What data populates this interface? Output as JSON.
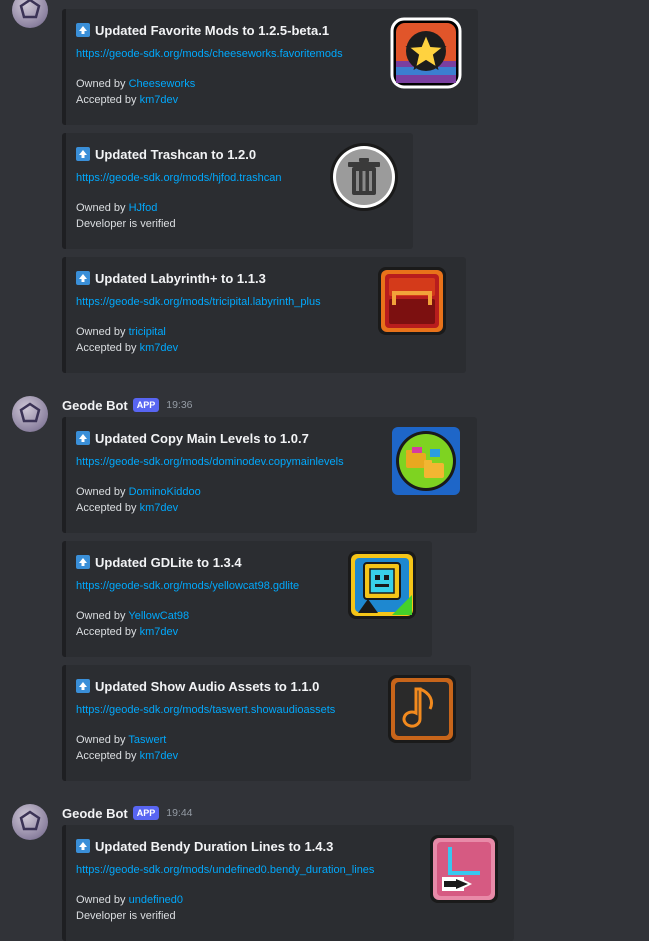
{
  "embed_fields": {
    "owned_by_label": "Owned by",
    "accepted_by_label": "Accepted by",
    "developer_verified_text": "Developer is verified"
  },
  "messages": [
    {
      "embeds": [
        {
          "title": "Updated Favorite Mods to 1.2.5-beta.1",
          "url": "https://geode-sdk.org/mods/cheeseworks.favoritemods",
          "owner": "Cheeseworks",
          "accepted_by": "km7dev",
          "icon": "star-mod-icon"
        },
        {
          "title": "Updated Trashcan to 1.2.0",
          "url": "https://geode-sdk.org/mods/hjfod.trashcan",
          "owner": "HJfod",
          "verified": true,
          "icon": "trashcan-mod-icon"
        },
        {
          "title": "Updated Labyrinth+ to 1.1.3",
          "url": "https://geode-sdk.org/mods/tricipital.labyrinth_plus",
          "owner": "tricipital",
          "accepted_by": "km7dev",
          "icon": "labyrinth-mod-icon"
        }
      ]
    },
    {
      "author": "Geode Bot",
      "tag": "APP",
      "time": "19:36",
      "embeds": [
        {
          "title": "Updated Copy Main Levels to 1.0.7",
          "url": "https://geode-sdk.org/mods/dominodev.copymainlevels",
          "owner": "DominoKiddoo",
          "accepted_by": "km7dev",
          "icon": "folder-mod-icon"
        },
        {
          "title": "Updated GDLite to 1.3.4",
          "url": "https://geode-sdk.org/mods/yellowcat98.gdlite",
          "owner": "YellowCat98",
          "accepted_by": "km7dev",
          "icon": "gd-cube-mod-icon"
        },
        {
          "title": "Updated Show Audio Assets to 1.1.0",
          "url": "https://geode-sdk.org/mods/taswert.showaudioassets",
          "owner": "Taswert",
          "accepted_by": "km7dev",
          "icon": "music-note-mod-icon"
        }
      ]
    },
    {
      "author": "Geode Bot",
      "tag": "APP",
      "time": "19:44",
      "embeds": [
        {
          "title": "Updated Bendy Duration Lines to 1.4.3",
          "url": "https://geode-sdk.org/mods/undefined0.bendy_duration_lines",
          "owner": "undefined0",
          "verified": true,
          "icon": "duration-lines-mod-icon"
        }
      ]
    }
  ]
}
